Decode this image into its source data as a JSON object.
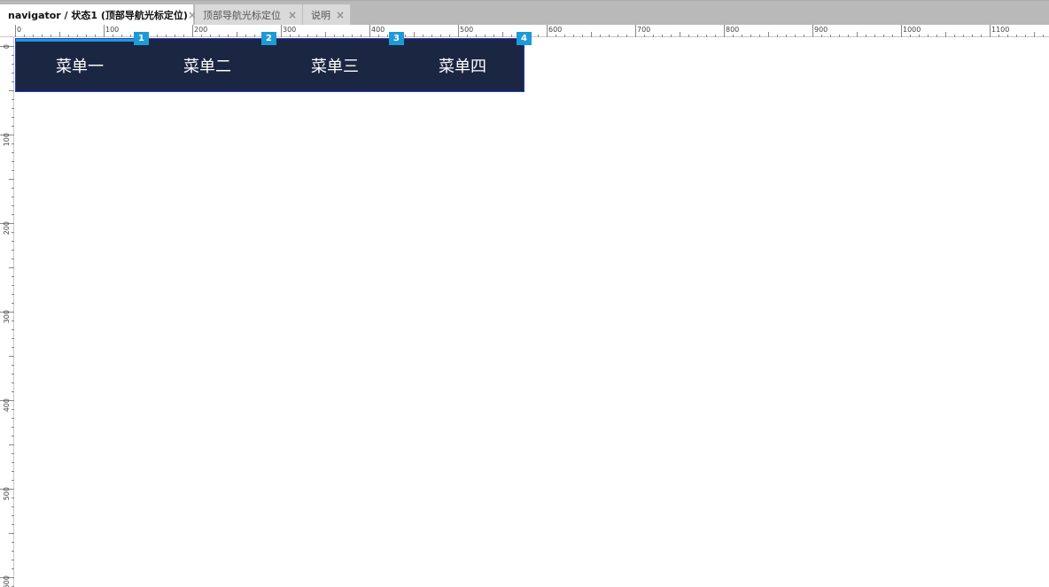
{
  "tabs": [
    {
      "label": "navigator / 状态1 (顶部导航光标定位)",
      "active": true
    },
    {
      "label": "顶部导航光标定位",
      "active": false
    },
    {
      "label": "说明",
      "active": false
    }
  ],
  "close_glyph": "×",
  "ruler": {
    "horizontal_labels": [
      "0",
      "100",
      "200",
      "300",
      "400",
      "500",
      "600",
      "700",
      "800",
      "900",
      "1000",
      "1100"
    ],
    "vertical_labels": [
      "0",
      "100",
      "200",
      "300",
      "400",
      "500",
      "600"
    ]
  },
  "nav": {
    "items": [
      {
        "label": "菜单一",
        "marker": "1"
      },
      {
        "label": "菜单二",
        "marker": "2"
      },
      {
        "label": "菜单三",
        "marker": "3"
      },
      {
        "label": "菜单四",
        "marker": "4"
      }
    ],
    "colors": {
      "background": "#1b2642",
      "cursor": "#1e9bd7",
      "marker": "#1e9bd7",
      "selection_border": "#2b3bd1"
    }
  }
}
